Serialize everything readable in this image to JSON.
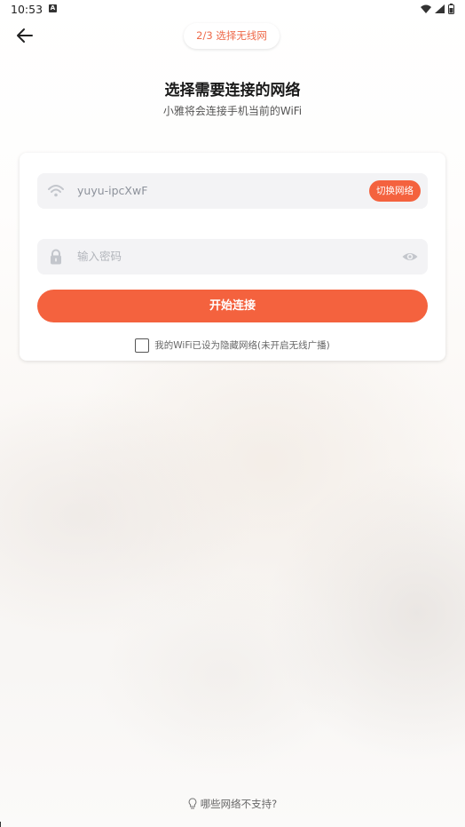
{
  "status_bar": {
    "time": "10:53",
    "notification_icon": "a-box-icon",
    "icons": [
      "wifi-signal-icon",
      "cell-signal-icon",
      "battery-icon"
    ]
  },
  "header": {
    "back_icon": "arrow-left-icon",
    "step_label": "2/3 选择无线网"
  },
  "page": {
    "title": "选择需要连接的网络",
    "subtitle": "小雅将会连接手机当前的WiFi"
  },
  "form": {
    "wifi_field": {
      "icon": "wifi-icon",
      "value": "yuyu-ipcXwF",
      "switch_label": "切换网络"
    },
    "password_field": {
      "icon": "lock-icon",
      "placeholder": "输入密码",
      "toggle_icon": "eye-icon"
    },
    "connect_label": "开始连接",
    "hidden_network": {
      "checked": false,
      "label": "我的WiFi已设为隐藏网络(未开启无线广播)"
    }
  },
  "footer": {
    "icon": "lightbulb-icon",
    "help_label": "哪些网络不支持?"
  },
  "colors": {
    "accent": "#f4623e",
    "step_text": "#ee6a4a"
  }
}
